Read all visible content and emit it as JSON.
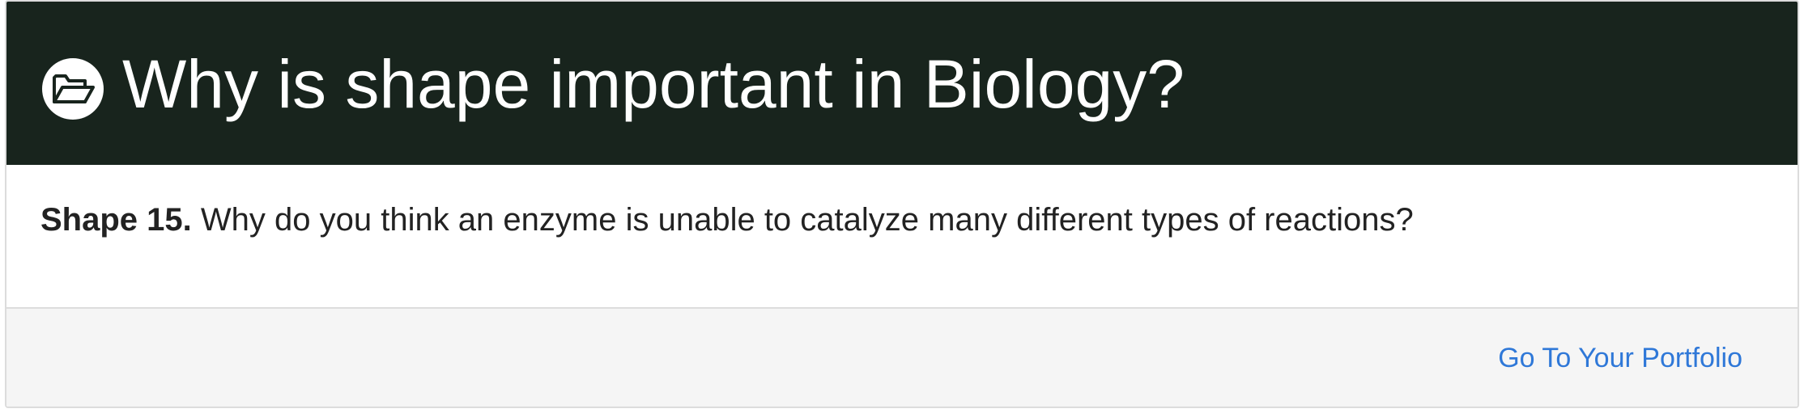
{
  "header": {
    "icon": "open-folder-icon",
    "title": "Why is shape important in Biology?",
    "background_color": "#18241d"
  },
  "body": {
    "question_label": "Shape 15.",
    "question_text": " Why do you think an enzyme is unable to catalyze many different types of reactions?"
  },
  "footer": {
    "link_label": "Go To Your Portfolio",
    "link_color": "#2f78d8"
  }
}
